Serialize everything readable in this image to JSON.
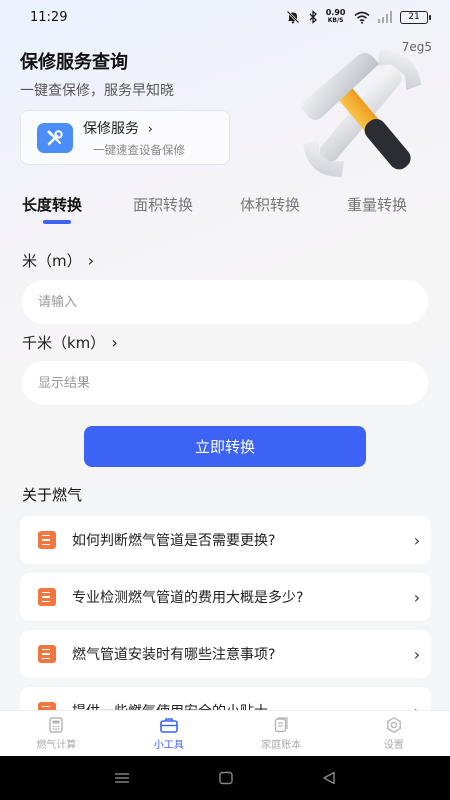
{
  "status_bar": {
    "time": "11:29",
    "net_speed_value": "0.90",
    "net_speed_unit": "KB/S",
    "battery": "21"
  },
  "banner": {
    "title": "保修服务查询",
    "subtitle": "一键查保修，服务早知晓",
    "code": "7eg5",
    "card_title": "保修服务",
    "card_subtitle": "一键速查设备保修"
  },
  "tabs": [
    {
      "label": "长度转换",
      "active": true
    },
    {
      "label": "面积转换",
      "active": false
    },
    {
      "label": "体积转换",
      "active": false
    },
    {
      "label": "重量转换",
      "active": false
    }
  ],
  "converter": {
    "from_label": "米（m）",
    "from_placeholder": "请输入",
    "to_label": "千米（km）",
    "to_placeholder": "显示结果",
    "button_label": "立即转换"
  },
  "articles": {
    "section_title": "关于燃气",
    "items": [
      "如何判断燃气管道是否需要更换?",
      "专业检测燃气管道的费用大概是多少?",
      "燃气管道安装时有哪些注意事项?",
      "提供一些燃气使用安全的小贴士"
    ]
  },
  "bottom_nav": [
    {
      "label": "燃气计算",
      "icon": "calculator-icon",
      "active": false
    },
    {
      "label": "小工具",
      "icon": "toolbox-icon",
      "active": true
    },
    {
      "label": "家庭账本",
      "icon": "ledger-icon",
      "active": false
    },
    {
      "label": "设置",
      "icon": "settings-icon",
      "active": false
    }
  ],
  "colors": {
    "accent": "#3d63f5",
    "article_icon": "#f2763f",
    "repair_icon": "#4c8ef7"
  }
}
